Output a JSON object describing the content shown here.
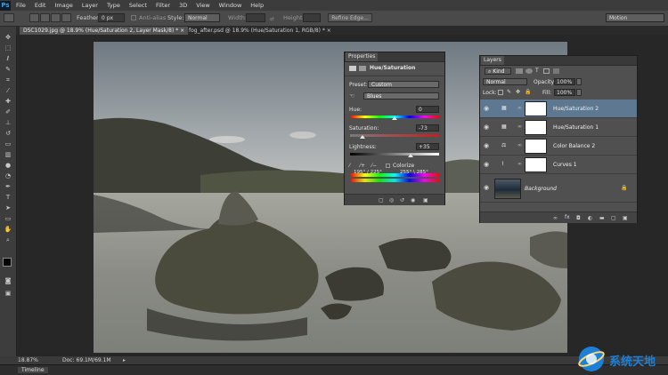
{
  "app": {
    "logo": "Ps"
  },
  "menu": [
    "File",
    "Edit",
    "Image",
    "Layer",
    "Type",
    "Select",
    "Filter",
    "3D",
    "View",
    "Window",
    "Help"
  ],
  "options_bar": {
    "feather_label": "Feather:",
    "feather_value": "0 px",
    "anti_alias_label": "Anti-alias",
    "style_label": "Style:",
    "style_value": "Normal",
    "width_label": "Width:",
    "height_label": "Height:",
    "refine_edge_label": "Refine Edge...",
    "workspace_value": "Motion"
  },
  "tabs": [
    {
      "label": "DSC1029.jpg @ 18.9% (Hue/Saturation 2, Layer Mask/8) *",
      "close": "×"
    },
    {
      "label": "fog_after.psd @ 18.9% (Hue/Saturation 1, RGB/8) *",
      "close": "×"
    }
  ],
  "properties": {
    "tab_label": "Properties",
    "title": "Hue/Saturation",
    "preset_label": "Preset:",
    "preset_value": "Custom",
    "channel_value": "Blues",
    "hue_label": "Hue:",
    "hue_value": "0",
    "saturation_label": "Saturation:",
    "saturation_value": "-73",
    "lightness_label": "Lightness:",
    "lightness_value": "+35",
    "colorize_label": "Colorize",
    "range_text": "195° / 225°",
    "range_text_2": "255° \\ 285°",
    "hue_fill": 0.5,
    "saturation_fill": 0.135,
    "lightness_fill": 0.675
  },
  "layers": {
    "tab_label": "Layers",
    "kind_label": "Kind",
    "blend_mode": "Normal",
    "opacity_label": "Opacity:",
    "opacity_value": "100%",
    "lock_label": "Lock:",
    "fill_label": "Fill:",
    "fill_value": "100%",
    "items": [
      {
        "name": "Hue/Saturation 2",
        "selected": true
      },
      {
        "name": "Hue/Saturation 1",
        "selected": false
      },
      {
        "name": "Color Balance 2",
        "selected": false
      },
      {
        "name": "Curves 1",
        "selected": false
      },
      {
        "name": "Background",
        "selected": false
      }
    ]
  },
  "status": {
    "zoom": "18.87%",
    "doc_info": "Doc: 69.1M/69.1M"
  },
  "timeline_label": "Timeline",
  "watermark": {
    "text": "系统天地"
  },
  "colors": {
    "accent": "#3a7fd0",
    "selected_layer": "#5f7891",
    "panel_bg": "#505050"
  }
}
